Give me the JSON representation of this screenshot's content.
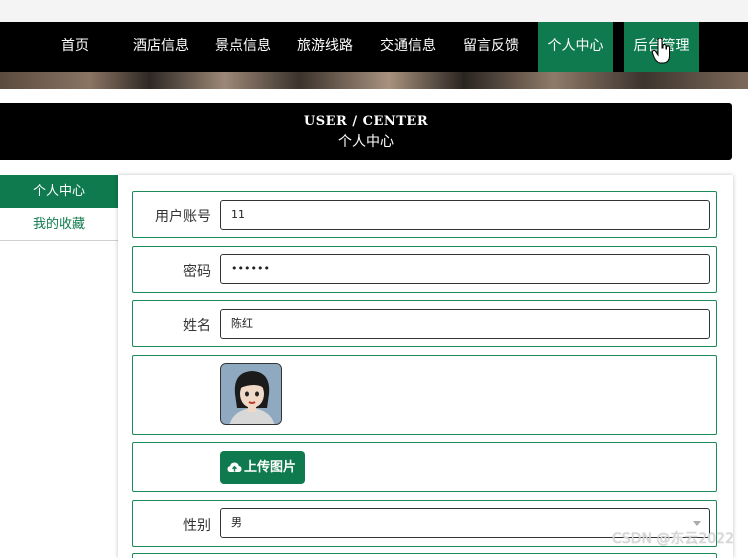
{
  "nav": {
    "items": [
      {
        "label": "首页"
      },
      {
        "label": "酒店信息"
      },
      {
        "label": "景点信息"
      },
      {
        "label": "旅游线路"
      },
      {
        "label": "交通信息"
      },
      {
        "label": "留言反馈"
      },
      {
        "label": "个人中心",
        "active": true
      },
      {
        "label": "后台管理",
        "active": true
      }
    ]
  },
  "header": {
    "title_en": "USER / CENTER",
    "title_cn": "个人中心"
  },
  "sidebar": {
    "items": [
      {
        "label": "个人中心",
        "active": true
      },
      {
        "label": "我的收藏"
      }
    ]
  },
  "form": {
    "account": {
      "label": "用户账号",
      "value": "11"
    },
    "password": {
      "label": "密码",
      "value": "••••••"
    },
    "name": {
      "label": "姓名",
      "value": "陈红"
    },
    "upload": {
      "label": "上传图片",
      "icon": "cloud-upload-icon"
    },
    "gender": {
      "label": "性别",
      "value": "男"
    }
  },
  "watermark": "CSDN @东云2022",
  "colors": {
    "accent": "#0e7a4d",
    "nav_bg": "#000000"
  }
}
